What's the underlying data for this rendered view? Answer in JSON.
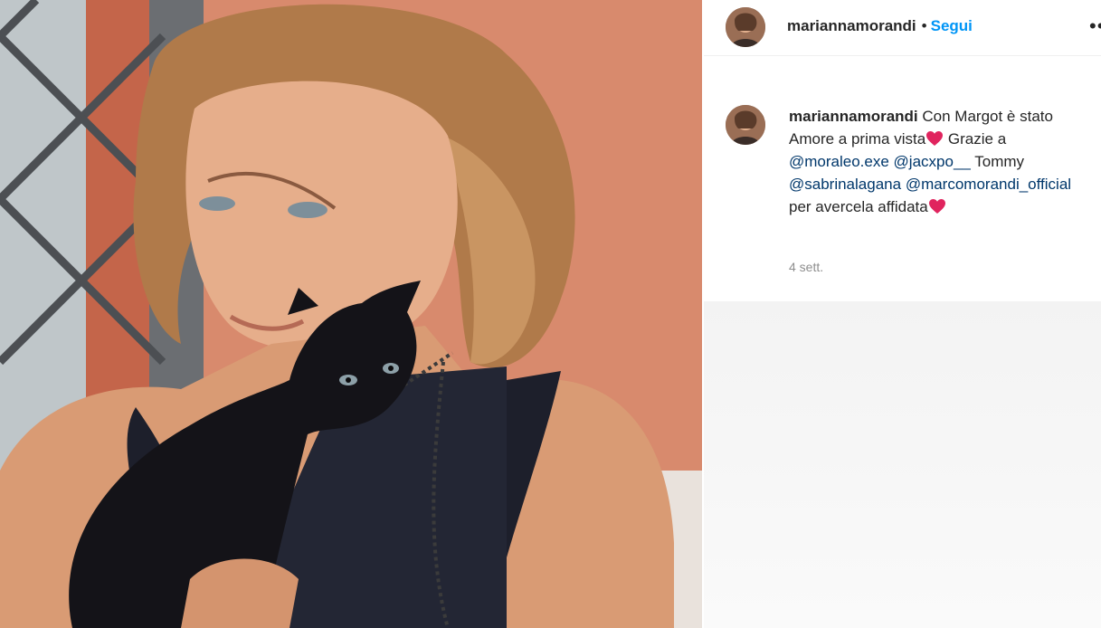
{
  "post": {
    "username": "mariannamorandi",
    "separator": "•",
    "follow_label": "Segui",
    "more_icon": "more-horizontal-icon",
    "caption": {
      "username": "mariannamorandi",
      "text_1": " Con Margot è stato Amore a prima vista",
      "text_2": " Grazie a ",
      "mention_1": "@moraleo.exe",
      "mention_2": "@jacxpo__",
      "text_3": " Tommy ",
      "mention_3": "@sabrinalagana",
      "mention_4": "@marcomorandi_official",
      "text_4": " per avercela affidata",
      "emoji": "red-heart-icon"
    },
    "timestamp": "4 sett."
  },
  "colors": {
    "link": "#0095f6",
    "mention": "#00376b",
    "muted": "#8e8e8e",
    "heart": "#e0245e"
  }
}
